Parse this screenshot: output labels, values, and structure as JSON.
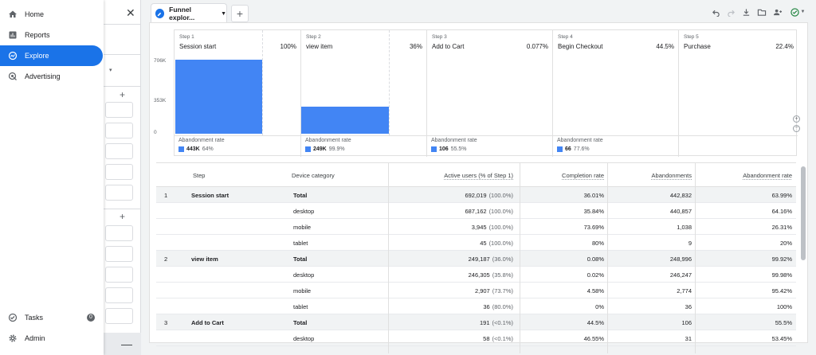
{
  "nav": {
    "items": [
      {
        "label": "Home",
        "icon": "home-icon"
      },
      {
        "label": "Reports",
        "icon": "bar-chart-icon"
      },
      {
        "label": "Explore",
        "icon": "explore-icon",
        "active": true
      },
      {
        "label": "Advertising",
        "icon": "advertising-icon"
      }
    ],
    "bottom": [
      {
        "label": "Tasks",
        "icon": "tasks-icon",
        "badge": "0"
      },
      {
        "label": "Admin",
        "icon": "gear-icon"
      }
    ]
  },
  "tab": {
    "label": "Funnel explor..."
  },
  "chart_data": {
    "type": "bar",
    "categories": [
      "Session start",
      "view item",
      "Add to Cart",
      "Begin Checkout",
      "Purchase"
    ],
    "steps": [
      "Step 1",
      "Step 2",
      "Step 3",
      "Step 4",
      "Step 5"
    ],
    "completion_pct": [
      "100%",
      "36%",
      "0.077%",
      "44.5%",
      "22.4%"
    ],
    "values": [
      692019,
      249187,
      191,
      85,
      19
    ],
    "yticks": [
      "706K",
      "353K",
      "0"
    ],
    "ylim": [
      0,
      706000
    ],
    "abandonment_label": "Abandonment rate",
    "abandonment": [
      {
        "count": "443K",
        "pct": "64%"
      },
      {
        "count": "249K",
        "pct": "99.9%"
      },
      {
        "count": "106",
        "pct": "55.5%"
      },
      {
        "count": "66",
        "pct": "77.6%"
      }
    ]
  },
  "table": {
    "headers": [
      "Step",
      "Device category",
      "Active users (% of Step 1)",
      "Completion rate",
      "Abandonments",
      "Abandonment rate"
    ],
    "rows": [
      {
        "num": "1",
        "step": "Session start",
        "device": "Total",
        "users": "692,019",
        "users_pct": "(100.0%)",
        "completion": "36.01%",
        "aband": "442,832",
        "aband_rate": "63.99%"
      },
      {
        "num": "",
        "step": "",
        "device": "desktop",
        "users": "687,162",
        "users_pct": "(100.0%)",
        "completion": "35.84%",
        "aband": "440,857",
        "aband_rate": "64.16%"
      },
      {
        "num": "",
        "step": "",
        "device": "mobile",
        "users": "3,945",
        "users_pct": "(100.0%)",
        "completion": "73.69%",
        "aband": "1,038",
        "aband_rate": "26.31%"
      },
      {
        "num": "",
        "step": "",
        "device": "tablet",
        "users": "45",
        "users_pct": "(100.0%)",
        "completion": "80%",
        "aband": "9",
        "aband_rate": "20%"
      },
      {
        "num": "2",
        "step": "view item",
        "device": "Total",
        "users": "249,187",
        "users_pct": "(36.0%)",
        "completion": "0.08%",
        "aband": "248,996",
        "aband_rate": "99.92%"
      },
      {
        "num": "",
        "step": "",
        "device": "desktop",
        "users": "246,305",
        "users_pct": "(35.8%)",
        "completion": "0.02%",
        "aband": "246,247",
        "aband_rate": "99.98%"
      },
      {
        "num": "",
        "step": "",
        "device": "mobile",
        "users": "2,907",
        "users_pct": "(73.7%)",
        "completion": "4.58%",
        "aband": "2,774",
        "aband_rate": "95.42%"
      },
      {
        "num": "",
        "step": "",
        "device": "tablet",
        "users": "36",
        "users_pct": "(80.0%)",
        "completion": "0%",
        "aband": "36",
        "aband_rate": "100%"
      },
      {
        "num": "3",
        "step": "Add to Cart",
        "device": "Total",
        "users": "191",
        "users_pct": "(<0.1%)",
        "completion": "44.5%",
        "aband": "106",
        "aband_rate": "55.5%"
      },
      {
        "num": "",
        "step": "",
        "device": "desktop",
        "users": "58",
        "users_pct": "(<0.1%)",
        "completion": "46.55%",
        "aband": "31",
        "aband_rate": "53.45%"
      }
    ]
  },
  "colors": {
    "accent": "#1a73e8",
    "bar": "#4285f4",
    "success": "#188038"
  }
}
